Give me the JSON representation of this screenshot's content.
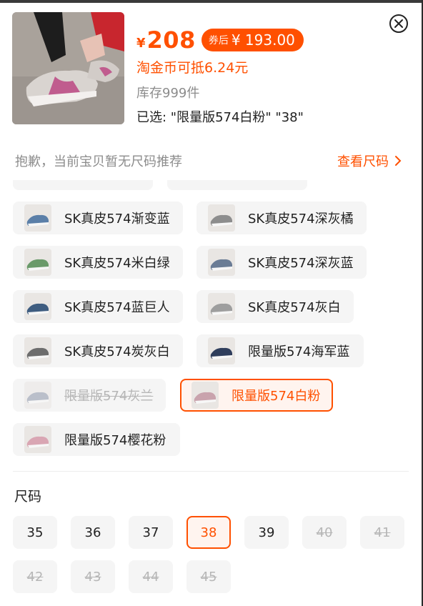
{
  "header": {
    "currency_symbol": "¥",
    "price": "208",
    "coupon_label": "券后",
    "coupon_price": "¥ 193.00",
    "coin_text": "淘金币可抵6.24元",
    "stock_text": "库存999件",
    "selected_text": "已选: \"限量版574白粉\" \"38\""
  },
  "size_recommend": {
    "note": "抱歉，当前宝贝暂无尺码推荐",
    "link_label": "查看尺码",
    "link_icon": "chevron-right-icon"
  },
  "colors": {
    "accent": "#ff5000",
    "chip_bg": "#f5f5f5",
    "disabled_text": "#b6b6b6"
  },
  "color_options": [
    {
      "label": "SK真皮574渐变蓝",
      "state": "normal",
      "thumb": "#5b7fa8"
    },
    {
      "label": "SK真皮574深灰橘",
      "state": "normal",
      "thumb": "#8d8d8d"
    },
    {
      "label": "SK真皮574米白绿",
      "state": "normal",
      "thumb": "#6a9a6a"
    },
    {
      "label": "SK真皮574深灰蓝",
      "state": "normal",
      "thumb": "#6a7c95"
    },
    {
      "label": "SK真皮574蓝巨人",
      "state": "normal",
      "thumb": "#3f5d80"
    },
    {
      "label": "SK真皮574灰白",
      "state": "normal",
      "thumb": "#9e9e9e"
    },
    {
      "label": "SK真皮574炭灰白",
      "state": "normal",
      "thumb": "#6d6d6d"
    },
    {
      "label": "限量版574海军蓝",
      "state": "normal",
      "thumb": "#2f3e5c"
    },
    {
      "label": "限量版574灰兰",
      "state": "disabled",
      "thumb": "#8a94a8"
    },
    {
      "label": "限量版574白粉",
      "state": "selected",
      "thumb": "#c9a3ad"
    },
    {
      "label": "限量版574樱花粉",
      "state": "normal",
      "thumb": "#d9a6b3"
    }
  ],
  "size_section": {
    "title": "尺码",
    "sizes": [
      {
        "label": "35",
        "state": "normal"
      },
      {
        "label": "36",
        "state": "normal"
      },
      {
        "label": "37",
        "state": "normal"
      },
      {
        "label": "38",
        "state": "selected"
      },
      {
        "label": "39",
        "state": "normal"
      },
      {
        "label": "40",
        "state": "disabled"
      },
      {
        "label": "41",
        "state": "disabled"
      },
      {
        "label": "42",
        "state": "disabled"
      },
      {
        "label": "43",
        "state": "disabled"
      },
      {
        "label": "44",
        "state": "disabled"
      },
      {
        "label": "45",
        "state": "disabled"
      }
    ]
  }
}
